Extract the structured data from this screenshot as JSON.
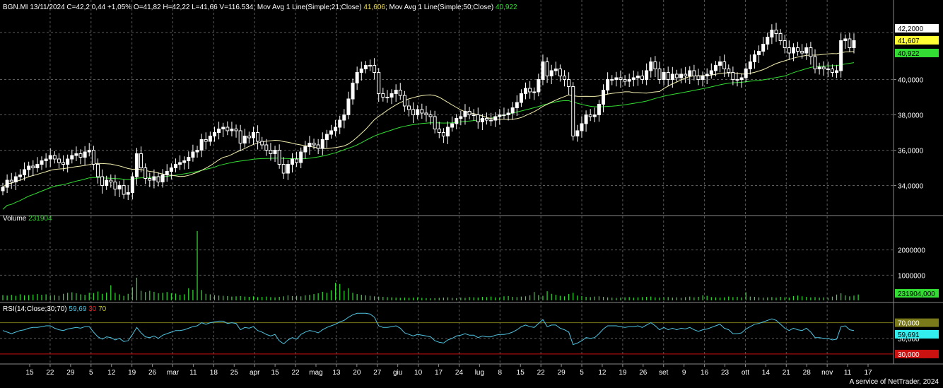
{
  "header": {
    "price_prefix": "BGN.MI 13/11/2024 C=42,2 0,44 +1,05% O=41,82 H=42,22 L=41,66 V=116.534; Mov Avg 1 Line(Simple;21;Close)",
    "ma21_value": "41,606",
    "ma50_prefix": "; Mov Avg 1 Line(Simple;50;Close)",
    "ma50_value": "40,922",
    "volume_label": "Volume",
    "volume_value": "231904",
    "rsi_label": "RSI(14;Close;30;70)",
    "rsi_value": "59,69",
    "rsi_low": "30",
    "rsi_high": "70"
  },
  "credit": "A service of NetTrader, 2024",
  "colors": {
    "background": "#000000",
    "grid": "#5a5a5a",
    "candle": "#ffffff",
    "ma21": "#f5f0b0",
    "ma50": "#33dd33",
    "volume": "#33dd33",
    "rsi": "#4fc3e0",
    "rsi_70": "#7a7a1a",
    "rsi_30": "#cc1111"
  },
  "chart_data": [
    {
      "type": "candlestick",
      "name": "price",
      "ylim": [
        32.5,
        44.5
      ],
      "y_ticks": [
        "34,0000",
        "36,0000",
        "38,0000",
        "40,0000"
      ],
      "grid": true,
      "x_ticks": [
        "15",
        "22",
        "29",
        "5",
        "12",
        "19",
        "26",
        "mar",
        "11",
        "18",
        "25",
        "apr",
        "15",
        "22",
        "mag",
        "13",
        "20",
        "27",
        "giu",
        "10",
        "17",
        "24",
        "lug",
        "8",
        "15",
        "22",
        "29",
        "5",
        "12",
        "19",
        "26",
        "set",
        "9",
        "16",
        "23",
        "ott",
        "14",
        "21",
        "28",
        "nov",
        "11",
        "17"
      ],
      "last_labels": {
        "close": "42,2000",
        "ma21": "41,607",
        "ma50": "40,922"
      },
      "close": [
        33.9,
        34.3,
        34.2,
        34.5,
        34.6,
        34.9,
        35.1,
        35.0,
        35.2,
        35.4,
        35.5,
        35.7,
        35.5,
        35.3,
        35.2,
        35.5,
        35.7,
        35.8,
        35.6,
        35.9,
        36.0,
        35.2,
        34.5,
        34.0,
        34.3,
        34.2,
        33.8,
        34.0,
        33.5,
        33.6,
        34.5,
        35.8,
        35.0,
        34.4,
        34.3,
        34.5,
        34.2,
        34.6,
        34.8,
        35.0,
        35.2,
        35.3,
        35.4,
        35.6,
        35.9,
        36.0,
        36.6,
        36.5,
        36.8,
        37.0,
        37.2,
        37.3,
        37.1,
        37.2,
        37.1,
        36.4,
        36.8,
        36.7,
        37.0,
        36.5,
        36.3,
        36.0,
        35.8,
        36.0,
        35.2,
        34.7,
        35.2,
        35.5,
        35.3,
        35.9,
        36.2,
        36.4,
        36.3,
        36.1,
        36.6,
        36.9,
        37.1,
        37.3,
        37.7,
        38.0,
        38.9,
        39.8,
        40.4,
        40.6,
        40.8,
        40.8,
        40.4,
        39.2,
        39.0,
        39.0,
        39.2,
        39.4,
        39.1,
        38.5,
        38.3,
        38.0,
        38.3,
        38.1,
        38.0,
        37.9,
        37.2,
        37.0,
        36.8,
        37.3,
        37.5,
        37.8,
        37.9,
        38.2,
        38.0,
        38.0,
        37.6,
        37.8,
        37.7,
        37.7,
        37.9,
        38.0,
        38.0,
        38.1,
        38.4,
        38.7,
        39.2,
        39.5,
        39.3,
        39.3,
        40.0,
        41.0,
        40.2,
        40.5,
        40.6,
        40.2,
        40.0,
        39.6,
        36.8,
        37.1,
        37.5,
        38.0,
        37.9,
        38.0,
        38.6,
        39.4,
        40.0,
        40.0,
        40.1,
        40.0,
        39.9,
        40.0,
        40.1,
        40.2,
        40.0,
        40.5,
        41.0,
        40.6,
        40.0,
        40.4,
        40.0,
        40.3,
        40.1,
        40.3,
        40.2,
        40.5,
        40.2,
        40.0,
        40.2,
        40.3,
        40.5,
        40.8,
        41.0,
        40.6,
        40.4,
        40.0,
        40.0,
        40.1,
        40.6,
        41.0,
        41.4,
        41.6,
        42.0,
        42.4,
        42.8,
        42.6,
        42.2,
        41.8,
        41.5,
        41.8,
        41.6,
        41.5,
        41.8,
        41.3,
        40.6,
        40.7,
        40.6,
        40.6,
        40.4,
        40.5,
        42.2,
        42.3,
        41.8,
        42.2
      ]
    },
    {
      "type": "bar",
      "name": "volume",
      "ylim": [
        0,
        3000000
      ],
      "y_ticks": [
        "1000000",
        "2000000"
      ],
      "last_label": "231904,000",
      "values": [
        210000,
        190000,
        220000,
        180000,
        240000,
        200000,
        210000,
        230000,
        250000,
        220000,
        240000,
        200000,
        210000,
        180000,
        260000,
        300000,
        320000,
        280000,
        240000,
        220000,
        300000,
        290000,
        350000,
        260000,
        310000,
        600000,
        300000,
        240000,
        180000,
        260000,
        520000,
        900000,
        380000,
        330000,
        380000,
        340000,
        280000,
        300000,
        330000,
        280000,
        270000,
        220000,
        240000,
        480000,
        420000,
        2750000,
        410000,
        260000,
        240000,
        210000,
        190000,
        180000,
        170000,
        150000,
        160000,
        170000,
        150000,
        140000,
        160000,
        130000,
        140000,
        150000,
        130000,
        120000,
        140000,
        160000,
        200000,
        170000,
        180000,
        160000,
        200000,
        220000,
        250000,
        280000,
        340000,
        300000,
        400000,
        700000,
        650000,
        380000,
        480000,
        300000,
        250000,
        220000,
        200000,
        180000,
        160000,
        150000,
        140000,
        130000,
        120000,
        110000,
        100000,
        110000,
        100000,
        110000,
        120000,
        100000,
        90000,
        80000,
        90000,
        100000,
        110000,
        120000,
        100000,
        90000,
        110000,
        100000,
        130000,
        120000,
        110000,
        140000,
        130000,
        150000,
        120000,
        110000,
        160000,
        170000,
        140000,
        130000,
        150000,
        160000,
        200000,
        330000,
        210000,
        180000,
        360000,
        260000,
        220000,
        180000,
        160000,
        250000,
        300000,
        190000,
        170000,
        140000,
        130000,
        150000,
        160000,
        140000,
        120000,
        110000,
        100000,
        110000,
        120000,
        130000,
        110000,
        120000,
        130000,
        140000,
        150000,
        120000,
        110000,
        120000,
        130000,
        110000,
        120000,
        100000,
        130000,
        150000,
        120000,
        140000,
        200000,
        180000,
        130000,
        120000,
        110000,
        120000,
        150000,
        130000,
        140000,
        120000,
        320000,
        150000,
        140000,
        120000,
        110000,
        120000,
        130000,
        110000,
        140000,
        120000,
        110000,
        170000,
        190000,
        160000,
        140000,
        120000,
        130000,
        110000,
        120000,
        100000,
        150000,
        230000,
        280000,
        200000,
        160000,
        190000,
        231904
      ]
    },
    {
      "type": "line",
      "name": "rsi",
      "ylim": [
        20,
        85
      ],
      "y_ticks": [
        "70,000",
        "50,000",
        "30,000"
      ],
      "last_label": "59,691",
      "values": [
        60,
        58,
        56,
        58,
        60,
        61,
        63,
        64,
        64,
        65,
        66,
        66,
        63,
        61,
        60,
        62,
        63,
        64,
        63,
        65,
        65,
        58,
        52,
        49,
        52,
        51,
        48,
        50,
        46,
        47,
        55,
        64,
        57,
        52,
        51,
        53,
        50,
        54,
        56,
        58,
        60,
        60,
        61,
        63,
        65,
        66,
        70,
        68,
        70,
        71,
        72,
        72,
        69,
        70,
        69,
        61,
        64,
        63,
        65,
        60,
        58,
        55,
        53,
        55,
        47,
        43,
        48,
        51,
        49,
        55,
        58,
        60,
        59,
        57,
        61,
        64,
        66,
        68,
        71,
        73,
        77,
        80,
        82,
        82,
        82,
        81,
        77,
        66,
        64,
        64,
        65,
        66,
        63,
        57,
        55,
        53,
        55,
        54,
        53,
        52,
        47,
        45,
        44,
        48,
        50,
        53,
        54,
        56,
        54,
        54,
        51,
        53,
        52,
        52,
        54,
        55,
        55,
        56,
        58,
        61,
        65,
        67,
        65,
        64,
        69,
        74,
        65,
        67,
        67,
        63,
        61,
        58,
        42,
        44,
        47,
        51,
        50,
        51,
        56,
        62,
        66,
        66,
        66,
        65,
        64,
        65,
        65,
        66,
        64,
        67,
        70,
        66,
        61,
        64,
        61,
        63,
        61,
        63,
        62,
        64,
        61,
        59,
        61,
        62,
        64,
        66,
        68,
        63,
        61,
        56,
        56,
        57,
        62,
        65,
        68,
        69,
        71,
        73,
        75,
        73,
        68,
        63,
        60,
        63,
        61,
        60,
        63,
        58,
        51,
        51,
        50,
        50,
        48,
        49,
        65,
        66,
        61,
        60
      ]
    }
  ]
}
